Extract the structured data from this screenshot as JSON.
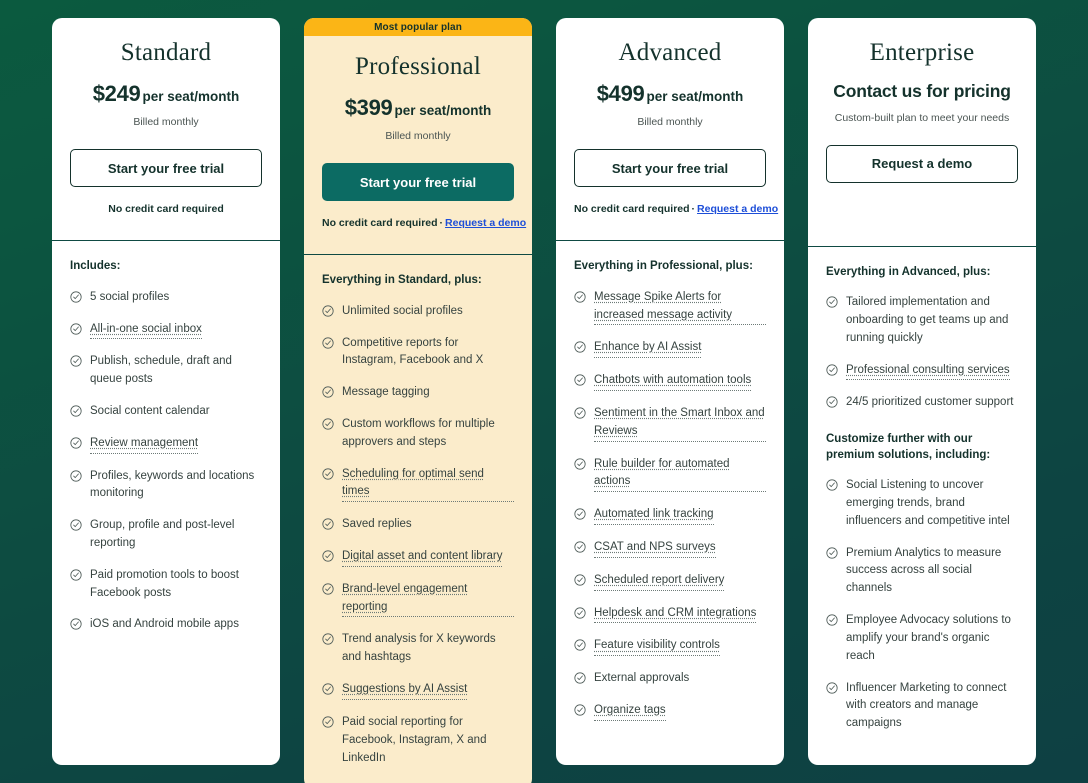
{
  "theme": {
    "background_top": "#0b5a3f",
    "background_bottom": "#0e4043",
    "card_bg": "#ffffff",
    "featured_card_bg": "#fbeccb",
    "badge_bg": "#fbb516",
    "primary_button_bg": "#0c6b63",
    "text_dark": "#14322c",
    "link_blue": "#1d4ed8"
  },
  "plans": [
    {
      "id": "standard",
      "badge": null,
      "name": "Standard",
      "price_amount": "$249",
      "price_unit": "per seat/month",
      "billing_note": "Billed monthly",
      "cta_label": "Start your free trial",
      "footnote_text": "No credit card required",
      "footnote_link": null,
      "features_title": "Includes:",
      "features": [
        {
          "text": "5 social profiles",
          "tooltip": false
        },
        {
          "text": "All-in-one social inbox",
          "tooltip": true
        },
        {
          "text": "Publish, schedule, draft and queue posts",
          "tooltip": false
        },
        {
          "text": "Social content calendar",
          "tooltip": false
        },
        {
          "text": "Review management",
          "tooltip": true
        },
        {
          "text": "Profiles, keywords and locations monitoring",
          "tooltip": false
        },
        {
          "text": "Group, profile and post-level reporting",
          "tooltip": false
        },
        {
          "text": "Paid promotion tools to boost Facebook posts",
          "tooltip": false
        },
        {
          "text": "iOS and Android mobile apps",
          "tooltip": false
        }
      ],
      "features_title_secondary": null,
      "features_secondary": []
    },
    {
      "id": "professional",
      "badge": "Most popular plan",
      "name": "Professional",
      "price_amount": "$399",
      "price_unit": "per seat/month",
      "billing_note": "Billed monthly",
      "cta_label": "Start your free trial",
      "footnote_text": "No credit card required",
      "footnote_link": "Request a demo",
      "features_title": "Everything in Standard, plus:",
      "features": [
        {
          "text": "Unlimited social profiles",
          "tooltip": false
        },
        {
          "text": "Competitive reports for Instagram, Facebook and X",
          "tooltip": false
        },
        {
          "text": "Message tagging",
          "tooltip": false
        },
        {
          "text": "Custom workflows for multiple approvers and steps",
          "tooltip": false
        },
        {
          "text": "Scheduling for optimal send times",
          "tooltip": true
        },
        {
          "text": "Saved replies",
          "tooltip": false
        },
        {
          "text": "Digital asset and content library",
          "tooltip": true
        },
        {
          "text": "Brand-level engagement reporting",
          "tooltip": true
        },
        {
          "text": "Trend analysis for X keywords and hashtags",
          "tooltip": false
        },
        {
          "text": "Suggestions by AI Assist",
          "tooltip": true
        },
        {
          "text": "Paid social reporting for Facebook, Instagram, X and LinkedIn",
          "tooltip": false
        }
      ],
      "features_title_secondary": null,
      "features_secondary": []
    },
    {
      "id": "advanced",
      "badge": null,
      "name": "Advanced",
      "price_amount": "$499",
      "price_unit": "per seat/month",
      "billing_note": "Billed monthly",
      "cta_label": "Start your free trial",
      "footnote_text": "No credit card required",
      "footnote_link": "Request a demo",
      "features_title": "Everything in Professional, plus:",
      "features": [
        {
          "text": "Message Spike Alerts for increased message activity",
          "tooltip": true
        },
        {
          "text": "Enhance by AI Assist",
          "tooltip": true
        },
        {
          "text": "Chatbots with automation tools",
          "tooltip": true
        },
        {
          "text": "Sentiment in the Smart Inbox and Reviews",
          "tooltip": true
        },
        {
          "text": "Rule builder for automated actions",
          "tooltip": true
        },
        {
          "text": "Automated link tracking",
          "tooltip": true
        },
        {
          "text": "CSAT and NPS surveys",
          "tooltip": true
        },
        {
          "text": "Scheduled report delivery",
          "tooltip": true
        },
        {
          "text": "Helpdesk and CRM integrations",
          "tooltip": true
        },
        {
          "text": "Feature visibility controls",
          "tooltip": true
        },
        {
          "text": "External approvals",
          "tooltip": false
        },
        {
          "text": "Organize tags",
          "tooltip": true
        }
      ],
      "features_title_secondary": null,
      "features_secondary": []
    },
    {
      "id": "enterprise",
      "badge": null,
      "name": "Enterprise",
      "price_amount": null,
      "price_unit": null,
      "price_contact": "Contact us for pricing",
      "billing_note": "Custom-built plan to meet your needs",
      "cta_label": "Request a demo",
      "footnote_text": null,
      "footnote_link": null,
      "features_title": "Everything in Advanced, plus:",
      "features": [
        {
          "text": "Tailored implementation and onboarding to get teams up and running quickly",
          "tooltip": false
        },
        {
          "text": "Professional consulting services",
          "tooltip": true
        },
        {
          "text": "24/5 prioritized customer support",
          "tooltip": false
        }
      ],
      "features_title_secondary": "Customize further with our premium solutions, including:",
      "features_secondary": [
        {
          "text": "Social Listening to uncover emerging trends, brand influencers and competitive intel",
          "tooltip": false
        },
        {
          "text": "Premium Analytics to measure success across all social channels",
          "tooltip": false
        },
        {
          "text": "Employee Advocacy solutions to amplify your brand's organic reach",
          "tooltip": false
        },
        {
          "text": "Influencer Marketing to connect with creators and manage campaigns",
          "tooltip": false
        }
      ]
    }
  ],
  "icons": {
    "check_circle": "check-circle-icon"
  }
}
